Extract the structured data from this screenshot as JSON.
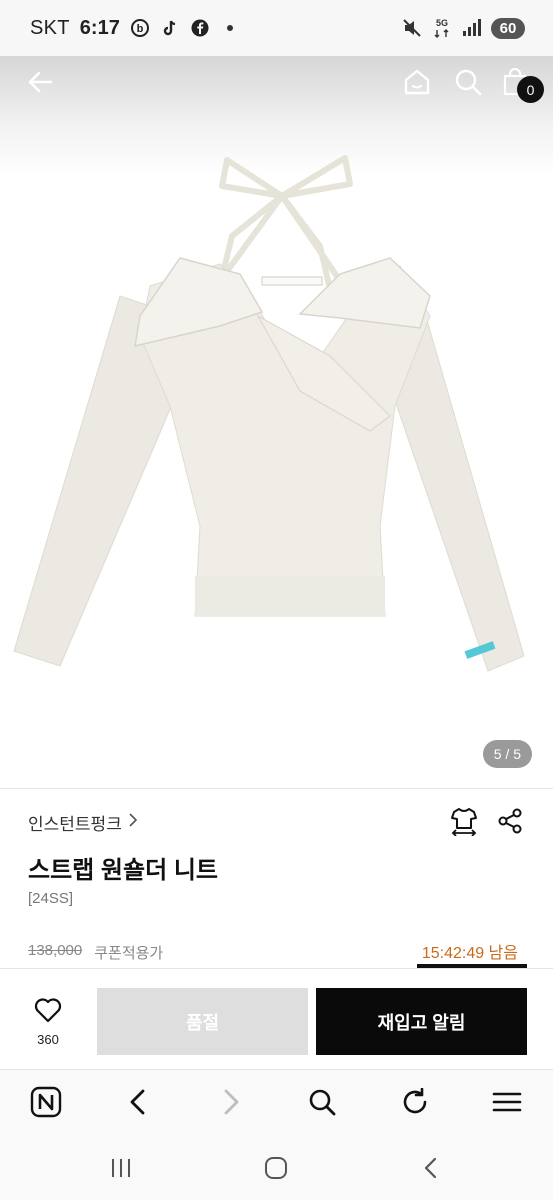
{
  "status_bar": {
    "carrier": "SKT",
    "time": "6:17",
    "network": "5G",
    "battery": "60",
    "icons": [
      "b-app-icon",
      "tiktok-icon",
      "facebook-icon",
      "dot-icon",
      "mute-icon",
      "5g-icon",
      "signal-icon"
    ]
  },
  "top_nav": {
    "icons": [
      "back-arrow-icon",
      "home-icon",
      "search-icon",
      "shopping-bag-icon"
    ],
    "cart_count": "0"
  },
  "gallery": {
    "pager": "5 / 5",
    "image": "white-halter-off-shoulder-knit-sweater"
  },
  "product": {
    "brand": "인스턴트펑크",
    "name": "스트랩 원숄더 니트",
    "season": "[24SS]",
    "original_price": "138,000",
    "coupon_label": "쿠폰적용가",
    "countdown": "15:42:49 남음",
    "countdown_color": "#c96a18"
  },
  "purchase_bar": {
    "like_count": "360",
    "soldout_label": "품절",
    "restock_label": "재입고 알림"
  },
  "browser_toolbar": {
    "icons": [
      "naver-n-icon",
      "back-icon",
      "forward-icon",
      "search-icon",
      "refresh-icon",
      "menu-icon"
    ]
  },
  "system_nav": {
    "icons": [
      "recent-apps-icon",
      "home-icon",
      "back-icon"
    ]
  }
}
